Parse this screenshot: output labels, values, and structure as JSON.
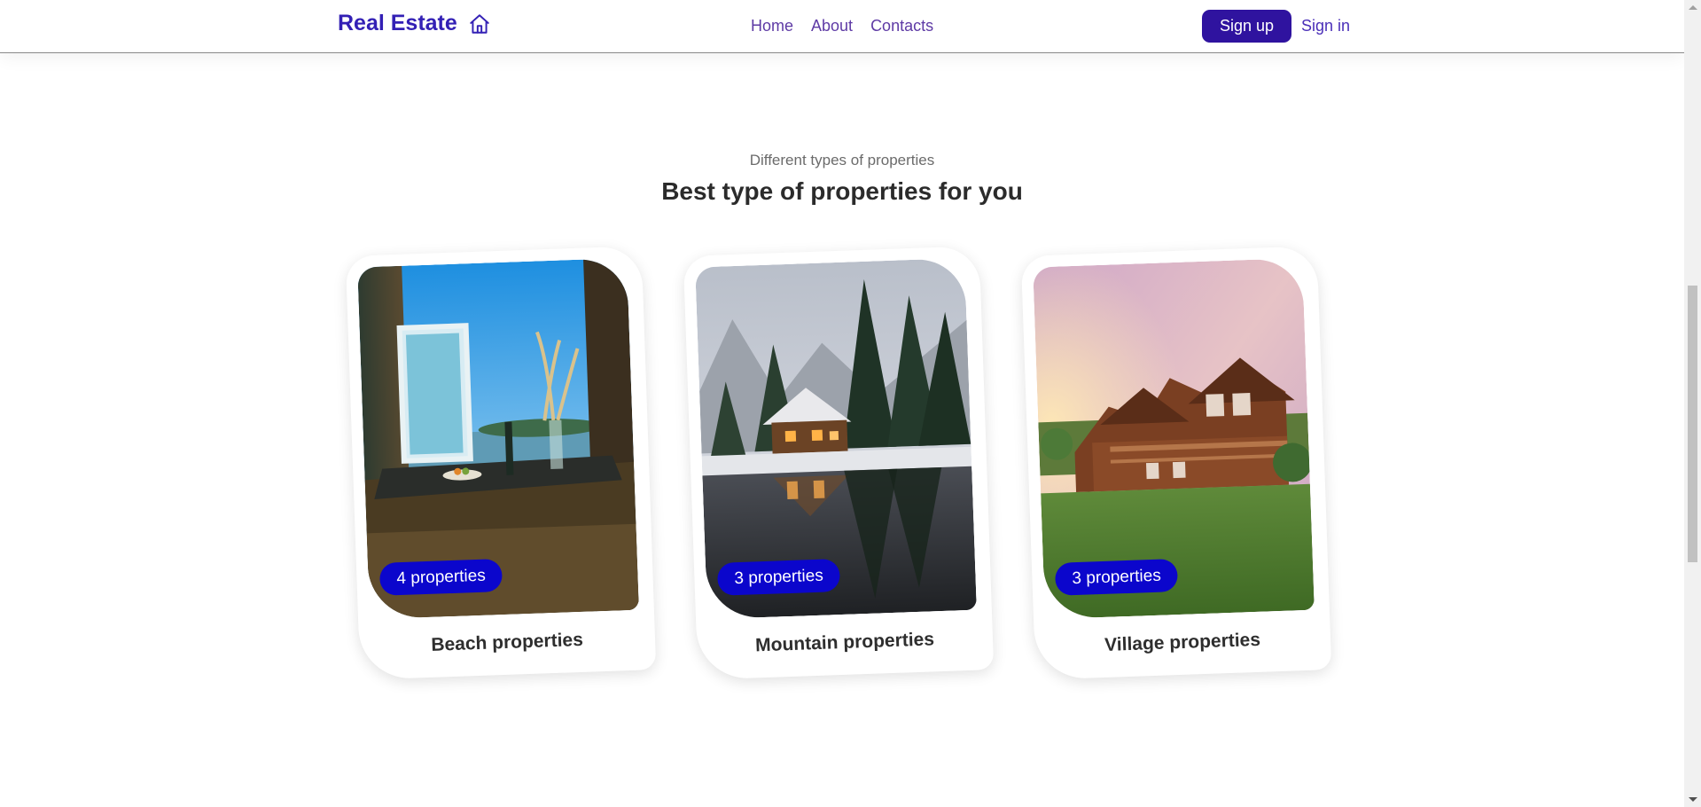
{
  "nav": {
    "brand": "Real Estate",
    "links": [
      "Home",
      "About",
      "Contacts"
    ],
    "signup": "Sign up",
    "signin": "Sign in"
  },
  "section": {
    "kicker": "Different types of properties",
    "heading": "Best type of properties for you"
  },
  "cards": [
    {
      "title": "Beach properties",
      "badge": "4 properties",
      "image": "beach-interior-photo"
    },
    {
      "title": "Mountain properties",
      "badge": "3 properties",
      "image": "snowy-cabin-lake-photo"
    },
    {
      "title": "Village properties",
      "badge": "3 properties",
      "image": "log-house-lawn-photo"
    }
  ],
  "colors": {
    "brand": "#3320b5",
    "nav_link": "#5e3aa5",
    "signup_bg": "#2f139f",
    "badge_bg": "#0b06cc"
  }
}
